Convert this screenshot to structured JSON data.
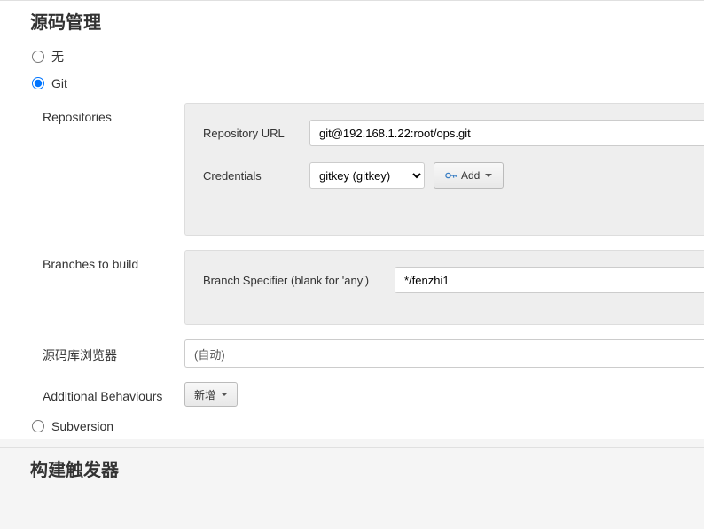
{
  "section_title": "源码管理",
  "scm_options": {
    "none": "无",
    "git": "Git",
    "subversion": "Subversion"
  },
  "selected_scm": "git",
  "repositories": {
    "label": "Repositories",
    "url_label": "Repository URL",
    "url_value": "git@192.168.1.22:root/ops.git",
    "credentials_label": "Credentials",
    "credentials_value": "gitkey (gitkey)",
    "add_button": "Add"
  },
  "branches": {
    "label": "Branches to build",
    "specifier_label": "Branch Specifier (blank for 'any')",
    "specifier_value": "*/fenzhi1"
  },
  "browser": {
    "label": "源码库浏览器",
    "value": "(自动)"
  },
  "additional": {
    "label": "Additional Behaviours",
    "button": "新增"
  },
  "next_section_title": "构建触发器"
}
